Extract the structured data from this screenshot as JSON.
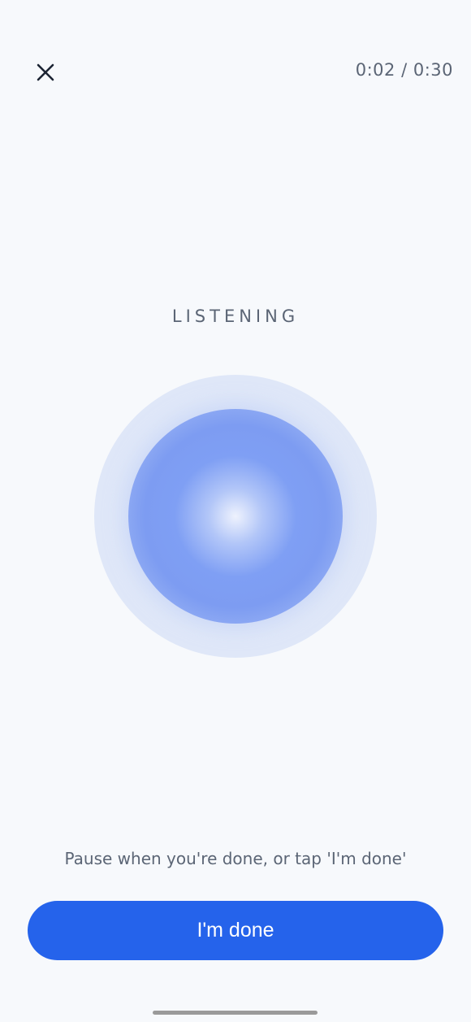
{
  "header": {
    "close_icon": "close-icon",
    "timer_text": "0:02 / 0:30"
  },
  "main": {
    "status_label": "LISTENING",
    "orb_colors": {
      "outer": "#dfe7f8",
      "inner_edge": "#b9cbf6",
      "inner_mid": "#7f9ff4",
      "center": "#eef2fd"
    }
  },
  "footer": {
    "hint_text": "Pause when you're done, or tap 'I'm done'",
    "done_label": "I'm done",
    "accent_color": "#2563eb"
  }
}
